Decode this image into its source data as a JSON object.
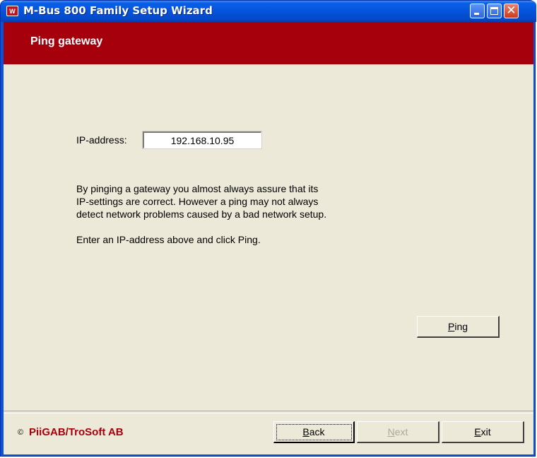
{
  "window": {
    "title": "M-Bus 800 Family Setup Wizard",
    "app_icon_letter": "W"
  },
  "header": {
    "title": "Ping gateway",
    "band_color": "#a7000d"
  },
  "form": {
    "ip_label": "IP-address:",
    "ip_value": "192.168.10.95"
  },
  "info": {
    "line1": "By pinging a gateway you almost always assure that its",
    "line2": "IP-settings are correct. However a ping may not always",
    "line3": "detect network problems caused by a bad network setup.",
    "line4": "Enter an IP-address above and click Ping."
  },
  "buttons": {
    "ping": {
      "accel": "P",
      "rest": "ing"
    },
    "back": {
      "accel": "B",
      "rest": "ack"
    },
    "next": {
      "accel": "N",
      "rest": "ext",
      "enabled": false
    },
    "exit": {
      "accel": "E",
      "rest": "xit"
    }
  },
  "footer": {
    "copyright_symbol": "©",
    "brand": "PiiGAB/TroSoft AB"
  }
}
